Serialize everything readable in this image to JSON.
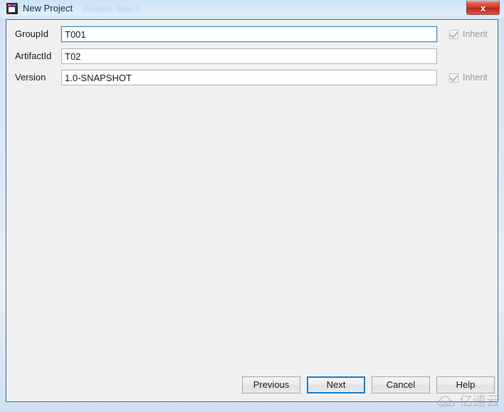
{
  "window": {
    "title": "New Project",
    "icon": "intellij-idea-icon",
    "ghost_title": "Project Test 1",
    "close_glyph": "x"
  },
  "form": {
    "rows": [
      {
        "label": "GroupId",
        "value": "T001",
        "placeholder": "",
        "focused": true,
        "inherit": {
          "label": "Inherit",
          "checked": true,
          "enabled": false,
          "visible": true
        }
      },
      {
        "label": "ArtifactId",
        "value": "T02",
        "placeholder": "",
        "focused": false,
        "inherit": {
          "label": "",
          "checked": false,
          "enabled": false,
          "visible": false
        }
      },
      {
        "label": "Version",
        "value": "1.0-SNAPSHOT",
        "placeholder": "",
        "focused": false,
        "inherit": {
          "label": "Inherit",
          "checked": true,
          "enabled": false,
          "visible": true
        }
      }
    ]
  },
  "buttons": {
    "previous": "Previous",
    "next": "Next",
    "cancel": "Cancel",
    "help": "Help",
    "default_button": "Next"
  },
  "watermark": {
    "text": "亿速云",
    "icon": "cloud-icon"
  },
  "colors": {
    "accent": "#1a7fd4",
    "focus_border": "#3d93bf",
    "titlebar": "#d6e8f8",
    "client_bg": "#f0f0f0",
    "close_button": "#d4392b"
  }
}
